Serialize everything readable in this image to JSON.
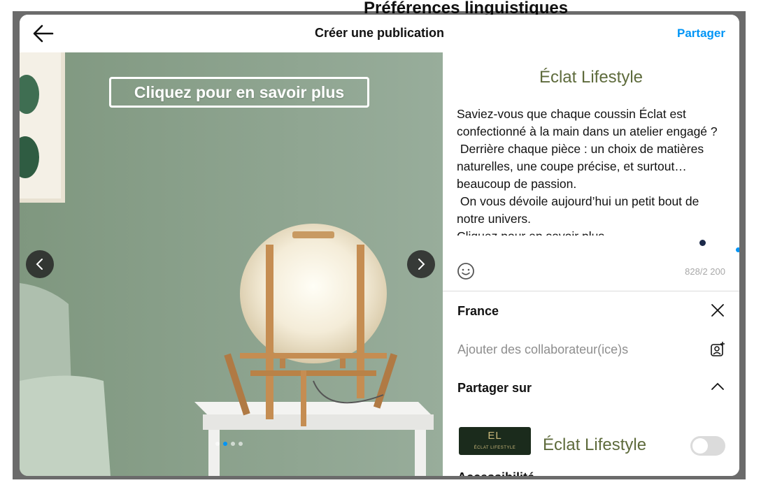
{
  "background_page": {
    "heading": "Préférences linguistiques"
  },
  "header": {
    "title": "Créer une publication",
    "share_label": "Partager"
  },
  "media": {
    "cta_label": "Cliquez pour en savoir plus",
    "dots_total": 4,
    "active_dot": 1
  },
  "panel": {
    "brand_title": "Éclat Lifestyle",
    "caption": "Saviez-vous que chaque coussin Éclat est confectionné à la main dans un atelier engagé ?\n Derrière chaque pièce : un choix de matières naturelles, une coupe précise, et surtout… beaucoup de passion.\n On vous dévoile aujourd’hui un petit bout de notre univers.\nCliquez pour en savoir plus",
    "char_count": "828/2 200",
    "location": "France",
    "collaborators_placeholder": "Ajouter des collaborateur(ice)s",
    "share_on_label": "Partager sur",
    "account": {
      "name": "Éclat Lifestyle",
      "logo_mark": "EL",
      "logo_sub": "ÉCLAT LIFESTYLE",
      "enabled": false
    },
    "accessibility_label": "Accessibilité"
  },
  "colors": {
    "accent": "#0095f6",
    "brand": "#5e6b3c",
    "wall": "#8fa694"
  }
}
